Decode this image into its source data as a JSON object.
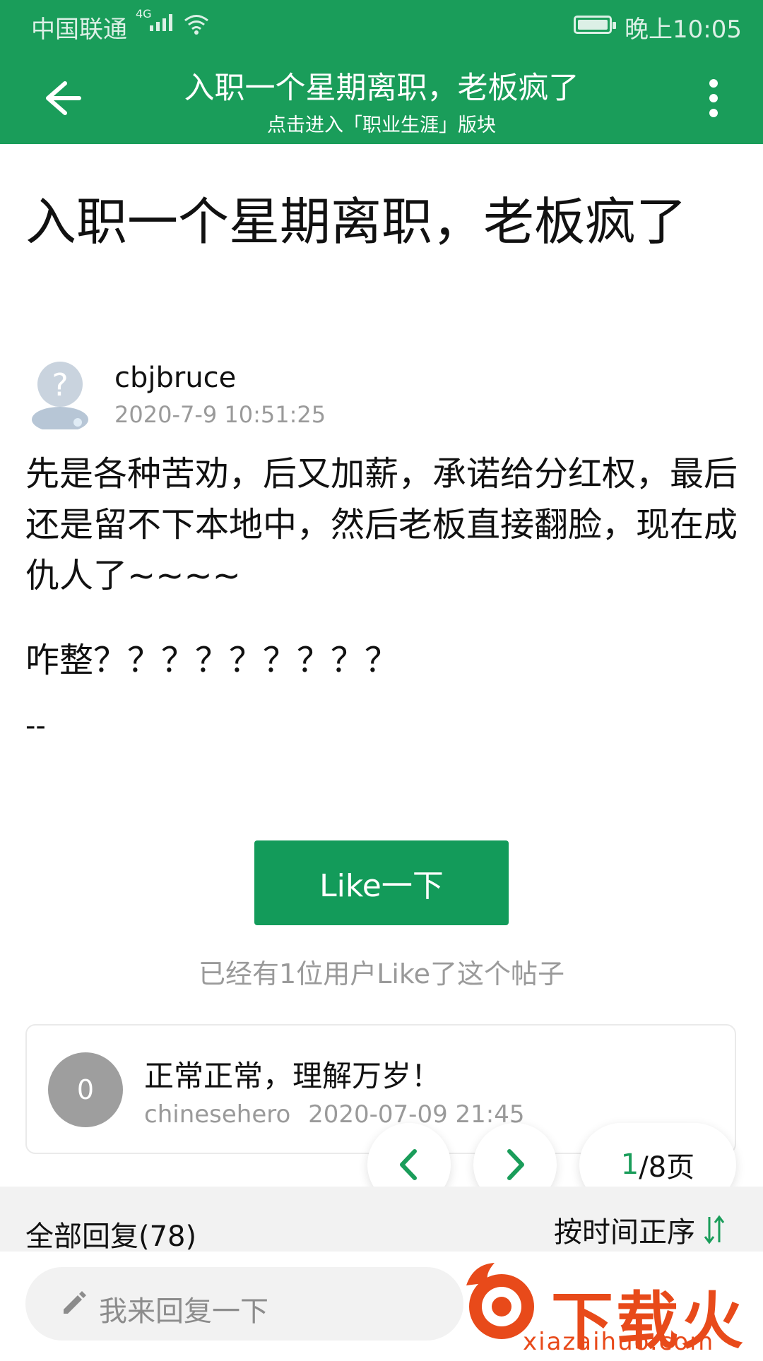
{
  "status_bar": {
    "carrier": "中国联通",
    "network": "4G",
    "time": "晚上10:05"
  },
  "header": {
    "title": "入职一个星期离职，老板疯了",
    "subtitle": "点击进入「职业生涯」版块"
  },
  "post": {
    "title": "入职一个星期离职，老板疯了",
    "author": "cbjbruce",
    "time": "2020-7-9 10:51:25",
    "body": "先是各种苦劝，后又加薪，承诺给分红权，最后还是留不下本地中，然后老板直接翻脸，现在成仇人了~~~~",
    "line2": "咋整？？？？？？？？？",
    "signature": "--"
  },
  "like": {
    "button_label": "Like一下",
    "count_text": "已经有1位用户Like了这个帖子"
  },
  "reply": {
    "avatar_text": "0",
    "text": "正常正常，理解万岁！",
    "user": "chinesehero",
    "time": "2020-07-09 21:45"
  },
  "pager": {
    "current": "1",
    "total": "/8页"
  },
  "replies_bar": {
    "all_label": "全部回复(78)",
    "sort_label": "按时间正序"
  },
  "reply_input": {
    "placeholder": "我来回复一下"
  },
  "watermark": {
    "text": "下载火",
    "domain": "xiazaihuo.com"
  },
  "colors": {
    "primary": "#1a9d5a",
    "like_button": "#139b5a",
    "muted_text": "#9a9a9a",
    "watermark": "#e84a1a"
  }
}
